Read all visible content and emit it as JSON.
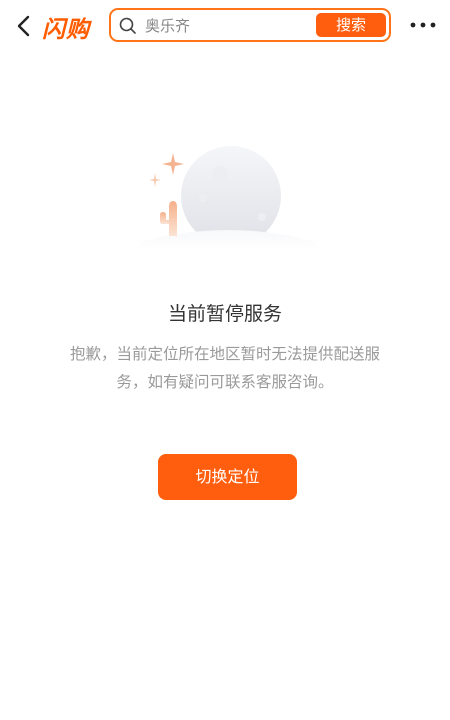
{
  "header": {
    "logo_text": "闪购",
    "search": {
      "value": "奥乐齐",
      "button_label": "搜索"
    }
  },
  "empty_state": {
    "title": "当前暂停服务",
    "message": "抱歉，当前定位所在地区暂时无法提供配送服务，如有疑问可联系客服咨询。",
    "action_label": "切换定位"
  },
  "colors": {
    "accent": "#ff5e0e",
    "search_border": "#ff7418",
    "title_text": "#333333",
    "body_text": "#9a9a9a"
  }
}
